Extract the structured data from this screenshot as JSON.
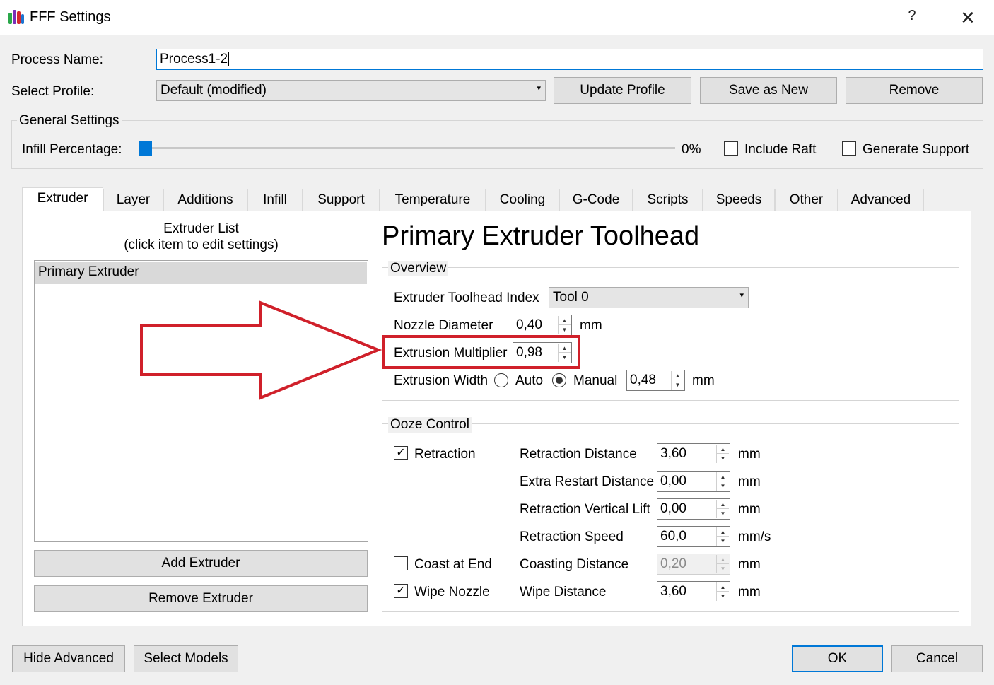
{
  "window": {
    "title": "FFF Settings",
    "help_glyph": "?",
    "close_glyph": "✕"
  },
  "process": {
    "name_label": "Process Name:",
    "name_value": "Process1-2",
    "profile_label": "Select Profile:",
    "profile_value": "Default (modified)",
    "update_label": "Update Profile",
    "save_new_label": "Save as New",
    "remove_label": "Remove"
  },
  "general": {
    "title": "General Settings",
    "infill_label": "Infill Percentage:",
    "infill_value": "0%",
    "infill_fraction": 0,
    "include_raft_label": "Include Raft",
    "include_raft_checked": false,
    "generate_support_label": "Generate Support",
    "generate_support_checked": false
  },
  "tabs": [
    {
      "label": "Extruder",
      "active": true
    },
    {
      "label": "Layer"
    },
    {
      "label": "Additions"
    },
    {
      "label": "Infill"
    },
    {
      "label": "Support"
    },
    {
      "label": "Temperature"
    },
    {
      "label": "Cooling"
    },
    {
      "label": "G-Code"
    },
    {
      "label": "Scripts"
    },
    {
      "label": "Speeds"
    },
    {
      "label": "Other"
    },
    {
      "label": "Advanced"
    }
  ],
  "extruder_list": {
    "title_line1": "Extruder List",
    "title_line2": "(click item to edit settings)",
    "items": [
      "Primary Extruder"
    ],
    "add_label": "Add Extruder",
    "remove_label": "Remove Extruder"
  },
  "toolhead": {
    "heading": "Primary Extruder Toolhead",
    "overview_title": "Overview",
    "index_label": "Extruder Toolhead Index",
    "index_value": "Tool 0",
    "nozzle_label": "Nozzle Diameter",
    "nozzle_value": "0,40",
    "nozzle_unit": "mm",
    "multiplier_label": "Extrusion Multiplier",
    "multiplier_value": "0,98",
    "width_label": "Extrusion Width",
    "width_auto_label": "Auto",
    "width_manual_label": "Manual",
    "width_mode": "Manual",
    "width_value": "0,48",
    "width_unit": "mm"
  },
  "ooze": {
    "title": "Ooze Control",
    "retraction_label": "Retraction",
    "retraction_checked": true,
    "coast_label": "Coast at End",
    "coast_checked": false,
    "wipe_label": "Wipe Nozzle",
    "wipe_checked": true,
    "fields": [
      {
        "label": "Retraction Distance",
        "value": "3,60",
        "unit": "mm"
      },
      {
        "label": "Extra Restart Distance",
        "value": "0,00",
        "unit": "mm"
      },
      {
        "label": "Retraction Vertical Lift",
        "value": "0,00",
        "unit": "mm"
      },
      {
        "label": "Retraction Speed",
        "value": "60,0",
        "unit": "mm/s"
      },
      {
        "label": "Coasting Distance",
        "value": "0,20",
        "unit": "mm",
        "disabled": true
      },
      {
        "label": "Wipe Distance",
        "value": "3,60",
        "unit": "mm"
      }
    ]
  },
  "footer": {
    "hide_advanced_label": "Hide Advanced",
    "select_models_label": "Select Models",
    "ok_label": "OK",
    "cancel_label": "Cancel"
  },
  "colors": {
    "accent": "#0078d7",
    "annotation_red": "#d0202a"
  },
  "icons": {
    "check": "✓",
    "spin_up": "▲",
    "spin_down": "▼",
    "combo_arrow": "▾"
  }
}
